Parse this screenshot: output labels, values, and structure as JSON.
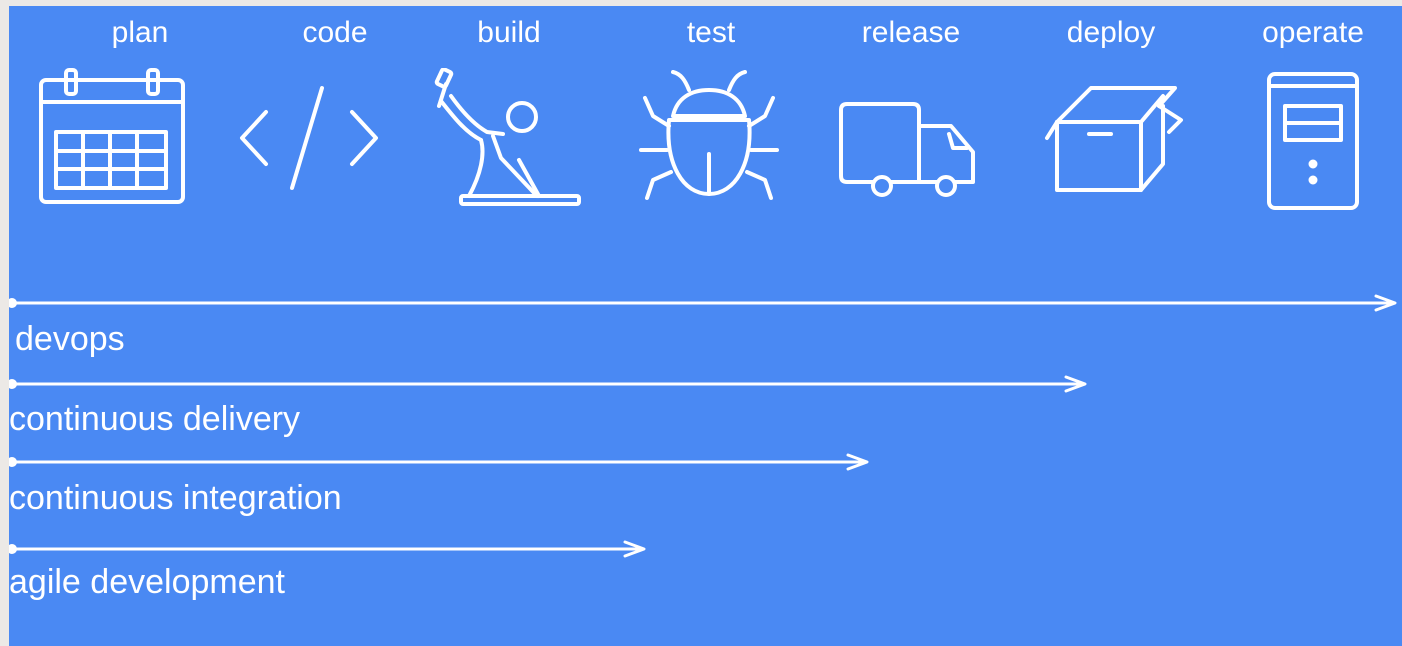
{
  "stages": [
    {
      "label": "plan",
      "icon": "calendar-icon"
    },
    {
      "label": "code",
      "icon": "code-brackets-icon"
    },
    {
      "label": "build",
      "icon": "builder-hammer-icon"
    },
    {
      "label": "test",
      "icon": "bug-icon"
    },
    {
      "label": "release",
      "icon": "truck-icon"
    },
    {
      "label": "deploy",
      "icon": "open-box-icon"
    },
    {
      "label": "operate",
      "icon": "server-icon"
    }
  ],
  "practices": [
    {
      "label": "devops",
      "spans_through": "operate"
    },
    {
      "label": "continuous delivery",
      "spans_through": "deploy"
    },
    {
      "label": "continuous integration",
      "spans_through": "release"
    },
    {
      "label": "agile development",
      "spans_through": "test"
    }
  ],
  "colors": {
    "background": "#4a89f3",
    "foreground": "#ffffff",
    "page": "#ece9e6"
  }
}
